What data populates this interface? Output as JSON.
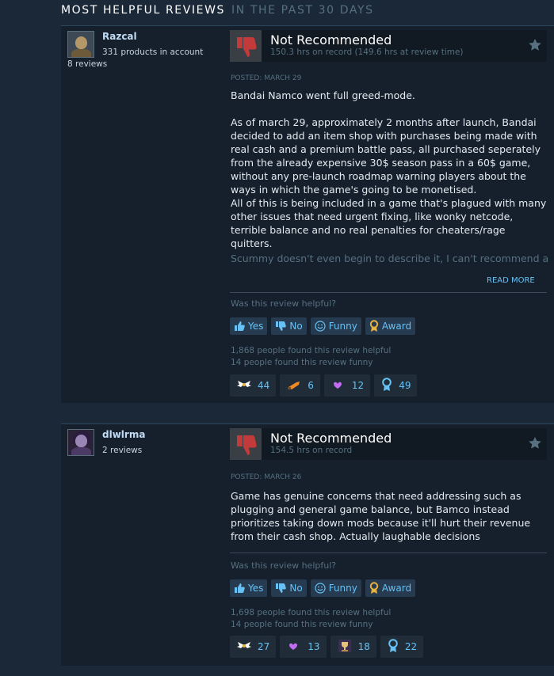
{
  "header": {
    "title": "MOST HELPFUL REVIEWS",
    "subtitle": "IN THE PAST 30 DAYS"
  },
  "colors": {
    "background": "#1b2838",
    "panel": "#16202d",
    "accent": "#67c1f5",
    "thumb_down": "#c33a3a"
  },
  "reviews": [
    {
      "author": {
        "name": "Razcal",
        "products": "331 products in account",
        "reviews": "8 reviews"
      },
      "verdict": "Not Recommended",
      "hours": "150.3 hrs on record (149.6 hrs at review time)",
      "posted": "POSTED: MARCH 29",
      "paragraphs": [
        "Bandai Namco went full greed-mode.",
        "As of march 29, approximately 2 months after launch, Bandai decided to add an item shop with purchases being made with real cash and a premium battle pass, all purchased seperately from the already expensive 30$ season pass in a 60$ game, without any pre-launch roadmap warning players about the ways in which the game's going to be monetised.",
        "All of this is being included in a game that's plagued with many other issues that need urgent fixing, like wonky netcode, terrible balance and no real penalties for cheaters/rage quitters."
      ],
      "faded_text": "Scummy doesn't even begin to describe it, I can't recommend a",
      "read_more": "READ MORE",
      "helpful_question": "Was this review helpful?",
      "buttons": {
        "yes": "Yes",
        "no": "No",
        "funny": "Funny",
        "award": "Award"
      },
      "helpful_count": "1,868 people found this review helpful",
      "funny_count": "14 people found this review funny",
      "awards": [
        {
          "icon": "wings-award-icon",
          "count": "44"
        },
        {
          "icon": "horn-award-icon",
          "count": "6"
        },
        {
          "icon": "heart-hands-award-icon",
          "count": "12"
        },
        {
          "icon": "medal-award-icon",
          "count": "49"
        }
      ]
    },
    {
      "author": {
        "name": "dlwlrma",
        "reviews": "2 reviews"
      },
      "verdict": "Not Recommended",
      "hours": "154.5 hrs on record",
      "posted": "POSTED: MARCH 26",
      "paragraphs": [
        "Game has genuine concerns that need addressing such as plugging and general game balance, but Bamco instead prioritizes taking down mods because it'll hurt their revenue from their cash shop. Actually laughable decisions"
      ],
      "helpful_question": "Was this review helpful?",
      "buttons": {
        "yes": "Yes",
        "no": "No",
        "funny": "Funny",
        "award": "Award"
      },
      "helpful_count": "1,698 people found this review helpful",
      "funny_count": "14 people found this review funny",
      "awards": [
        {
          "icon": "wings-award-icon",
          "count": "27"
        },
        {
          "icon": "heart-hands-award-icon",
          "count": "13"
        },
        {
          "icon": "trophy-award-icon",
          "count": "18"
        },
        {
          "icon": "medal-award-icon",
          "count": "22"
        }
      ]
    }
  ]
}
